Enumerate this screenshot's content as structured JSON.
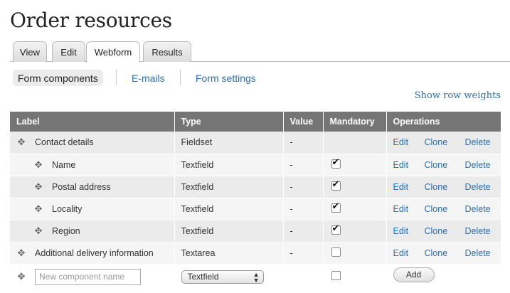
{
  "page_title": "Order resources",
  "primary_tabs": [
    {
      "label": "View"
    },
    {
      "label": "Edit"
    },
    {
      "label": "Webform"
    },
    {
      "label": "Results"
    }
  ],
  "secondary_tabs": [
    {
      "label": "Form components"
    },
    {
      "label": "E-mails"
    },
    {
      "label": "Form settings"
    }
  ],
  "row_weights_link": "Show row weights",
  "table": {
    "headers": [
      "Label",
      "Type",
      "Value",
      "Mandatory",
      "Operations"
    ],
    "rows": [
      {
        "label": "Contact details",
        "type": "Fieldset",
        "value": "-",
        "mandatory": null,
        "ops": [
          "Edit",
          "Clone",
          "Delete"
        ]
      },
      {
        "label": "Name",
        "type": "Textfield",
        "value": "-",
        "mandatory": true,
        "ops": [
          "Edit",
          "Clone",
          "Delete"
        ]
      },
      {
        "label": "Postal address",
        "type": "Textfield",
        "value": "-",
        "mandatory": true,
        "ops": [
          "Edit",
          "Clone",
          "Delete"
        ]
      },
      {
        "label": "Locality",
        "type": "Textfield",
        "value": "-",
        "mandatory": true,
        "ops": [
          "Edit",
          "Clone",
          "Delete"
        ]
      },
      {
        "label": "Region",
        "type": "Textfield",
        "value": "-",
        "mandatory": true,
        "ops": [
          "Edit",
          "Clone",
          "Delete"
        ]
      },
      {
        "label": "Additional delivery information",
        "type": "Textarea",
        "value": "-",
        "mandatory": false,
        "ops": [
          "Edit",
          "Clone",
          "Delete"
        ]
      }
    ],
    "add_row": {
      "name_placeholder": "New component name",
      "type_selected": "Textfield",
      "mandatory": false,
      "add_label": "Add"
    }
  },
  "colors": {
    "link": "#2a6fb0",
    "header_bg": "#757575"
  }
}
